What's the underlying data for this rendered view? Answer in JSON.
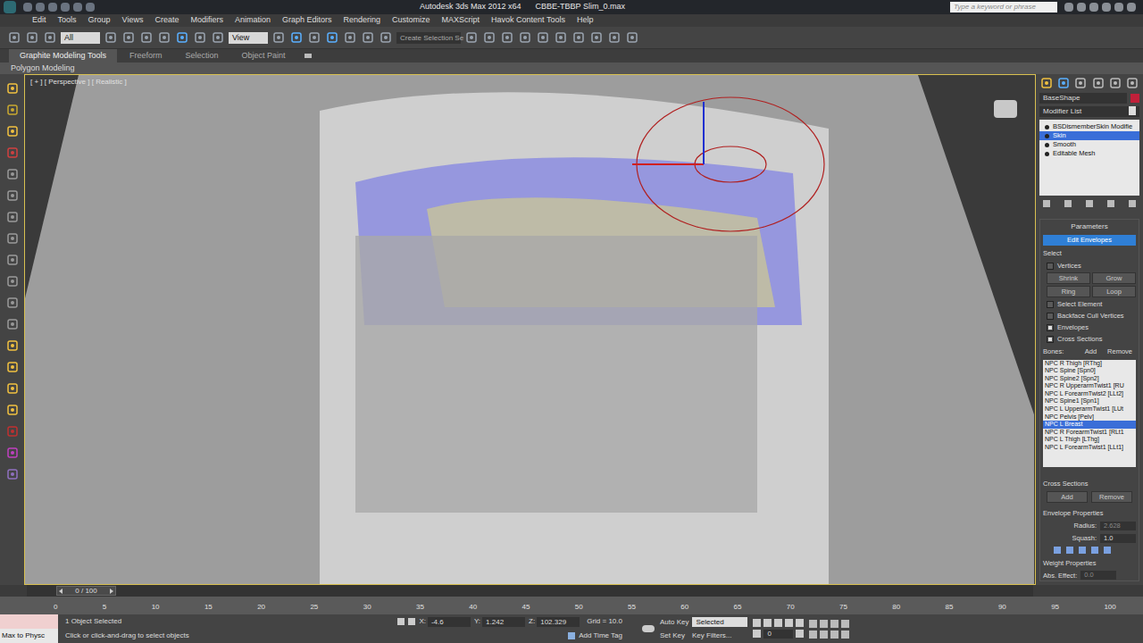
{
  "window": {
    "title": "Autodesk 3ds Max  2012 x64",
    "file": "CBBE-TBBP Slim_0.max"
  },
  "search": {
    "placeholder": "Type a keyword or phrase"
  },
  "menu": [
    "Edit",
    "Tools",
    "Group",
    "Views",
    "Create",
    "Modifiers",
    "Animation",
    "Graph Editors",
    "Rendering",
    "Customize",
    "MAXScript",
    "Havok Content Tools",
    "Help"
  ],
  "toolbar": {
    "selection_filter": "All",
    "reference_coord": "View",
    "named_selection": "Create Selection Se"
  },
  "ribbon": {
    "tabs": [
      {
        "label": "Graphite Modeling Tools",
        "selected": true
      },
      {
        "label": "Freeform",
        "selected": false
      },
      {
        "label": "Selection",
        "selected": false
      },
      {
        "label": "Object Paint",
        "selected": false
      }
    ],
    "panel": "Polygon Modeling"
  },
  "viewport": {
    "label": "[ + ] [ Perspective ] [ Realistic ]",
    "active": true
  },
  "command_panel": {
    "object_name": "BaseShape",
    "modifier_list": "Modifier List",
    "stack": [
      {
        "label": "BSDismemberSkin Modifie",
        "selected": false
      },
      {
        "label": "Skin",
        "selected": true
      },
      {
        "label": "Smooth",
        "selected": false
      },
      {
        "label": "Editable Mesh",
        "selected": false
      }
    ]
  },
  "parameters": {
    "title": "Parameters",
    "edit_envelopes": {
      "label": "Edit Envelopes",
      "on": true
    },
    "select_title": "Select",
    "checks": [
      {
        "label": "Vertices",
        "checked": false
      }
    ],
    "select_buttons": [
      "Shrink",
      "Grow",
      "Ring",
      "Loop"
    ],
    "options": [
      {
        "label": "Select Element",
        "checked": false
      },
      {
        "label": "Backface Cull Vertices",
        "checked": false
      },
      {
        "label": "Envelopes",
        "checked": true
      },
      {
        "label": "Cross Sections",
        "checked": true
      }
    ],
    "bones_label": "Bones:",
    "bones_buttons": [
      "Add",
      "Remove"
    ],
    "bones": [
      {
        "label": "NPC R Thigh [RThg]",
        "selected": false
      },
      {
        "label": "NPC Spine [Spn0]",
        "selected": false
      },
      {
        "label": "NPC Spine2 [Spn2]",
        "selected": false
      },
      {
        "label": "NPC R UpperarmTwist1 [RU",
        "selected": false
      },
      {
        "label": "NPC L ForearmTwist2 [LLt2]",
        "selected": false
      },
      {
        "label": "NPC Spine1 [Spn1]",
        "selected": false
      },
      {
        "label": "NPC L UpperarmTwist1 [LUt",
        "selected": false
      },
      {
        "label": "NPC Pelvis [Pelv]",
        "selected": false
      },
      {
        "label": "NPC L Breast",
        "selected": true
      },
      {
        "label": "NPC R ForearmTwist1 [RLt1",
        "selected": false
      },
      {
        "label": "NPC L Thigh [LThg]",
        "selected": false
      },
      {
        "label": "NPC L ForearmTwist1 [LLt1]",
        "selected": false
      }
    ],
    "cross_sections": {
      "title": "Cross Sections",
      "buttons": [
        "Add",
        "Remove"
      ]
    },
    "envelope_properties": {
      "title": "Envelope Properties",
      "fields": [
        {
          "label": "Radius:",
          "value": "2.628",
          "disabled": true
        },
        {
          "label": "Squash:",
          "value": "1.0",
          "disabled": false
        }
      ]
    },
    "weight_properties": {
      "title": "Weight Properties",
      "field": {
        "label": "Abs. Effect:",
        "value": "0.0"
      }
    }
  },
  "timeline": {
    "position": "0 / 100",
    "level": 0,
    "ticks": [
      "0",
      "5",
      "10",
      "15",
      "20",
      "25",
      "30",
      "35",
      "40",
      "45",
      "50",
      "55",
      "60",
      "65",
      "70",
      "75",
      "80",
      "85",
      "90",
      "95",
      "100"
    ]
  },
  "status_bar": {
    "script_listener": "Max to Physc",
    "selection": "1 Object Selected",
    "prompt": "Click or click-and-drag to select objects",
    "coords": [
      {
        "label": "X:",
        "value": "-4.6"
      },
      {
        "label": "Y:",
        "value": "1.242"
      },
      {
        "label": "Z:",
        "value": "102.329"
      }
    ],
    "grid": "Grid = 10.0",
    "add_time_tag": "Add Time Tag",
    "auto_key": "Auto Key",
    "key_mode": "Selected",
    "set_key": "Set Key",
    "key_filters": "Key Filters...",
    "frame": "0"
  }
}
